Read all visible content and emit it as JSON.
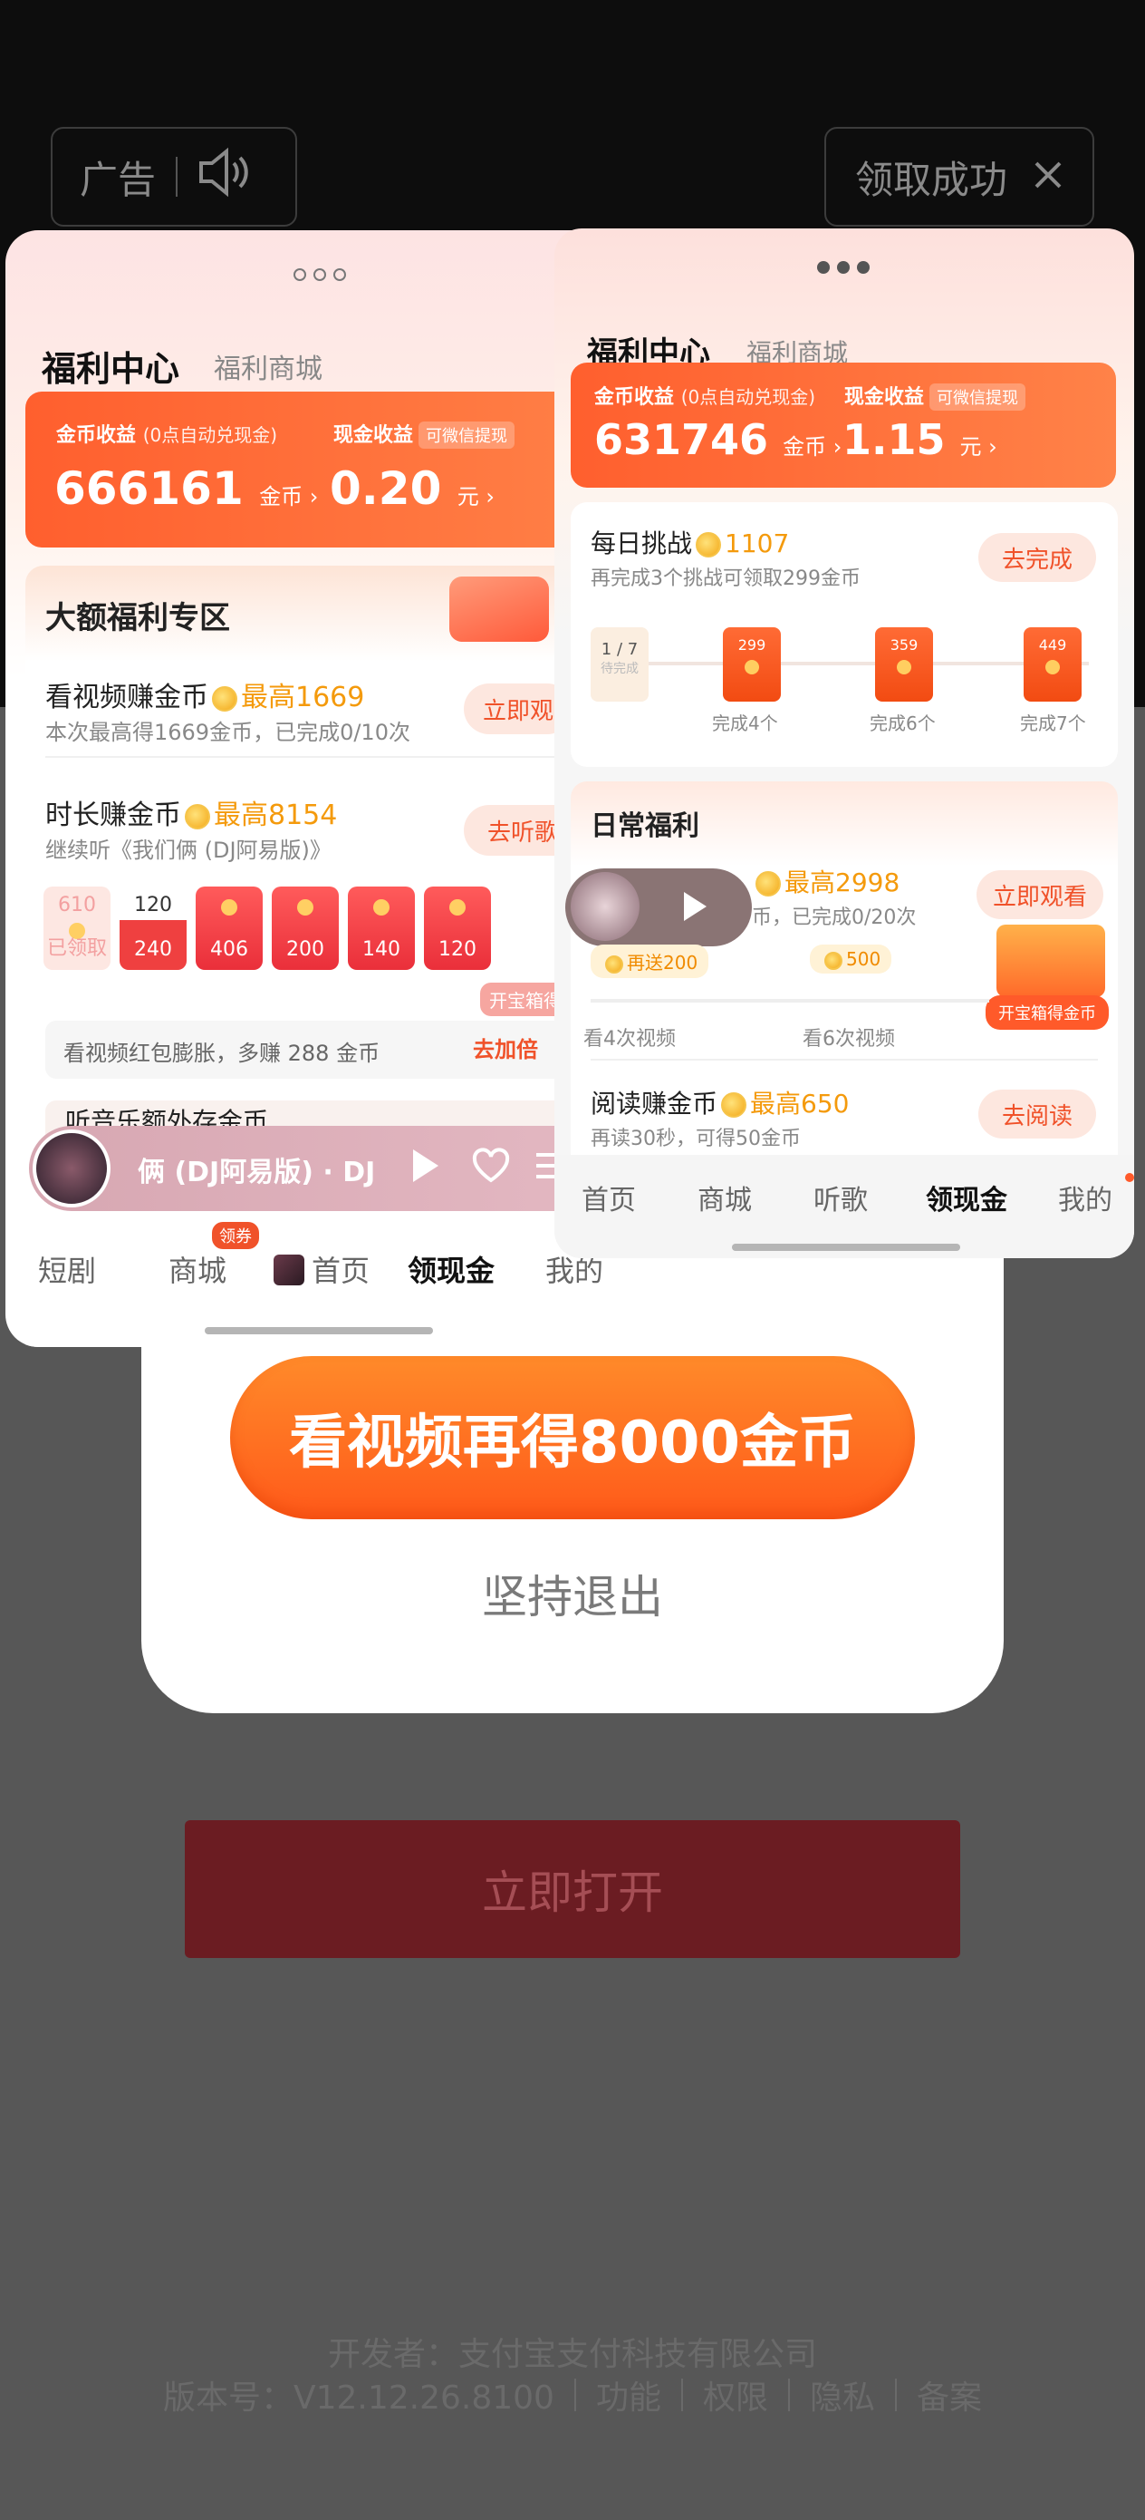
{
  "ad_bar": {
    "ad_label": "广告",
    "claim_label": "领取成功"
  },
  "dialog": {
    "cta": "看视频再得8000金币",
    "quit": "坚持退出"
  },
  "open_button": "立即打开",
  "footer": {
    "developer": "开发者：支付宝支付科技有限公司",
    "version": "版本号：V12.12.26.8100",
    "links": [
      "功能",
      "权限",
      "隐私",
      "备案"
    ]
  },
  "left_card": {
    "tabs": [
      "福利中心",
      "福利商城"
    ],
    "coin_label": "金币收益",
    "coin_note": "(0点自动兑现金)",
    "coin_value": "666161",
    "coin_unit": "金币 ›",
    "cash_label": "现金收益",
    "wechat": "可微信提现",
    "cash_value": "0.20",
    "cash_unit": "元 ›",
    "zone_title": "大额福利专区",
    "video_title": "看视频赚金币",
    "video_max": "最高1669",
    "video_sub": "本次最高得1669金币，已完成0/10次",
    "video_btn": "立即观",
    "listen_title": "时长赚金币",
    "listen_max": "最高8154",
    "listen_sub": "继续听《我们俩 (DJ阿易版)》",
    "listen_btn": "去听歌",
    "packets": [
      {
        "top": "610",
        "bottom": "已领取"
      },
      {
        "top": "120",
        "bottom": "240"
      },
      {
        "top": "",
        "bottom": "406"
      },
      {
        "top": "",
        "bottom": "200"
      },
      {
        "top": "",
        "bottom": "140"
      },
      {
        "top": "",
        "bottom": "120"
      }
    ],
    "treasure_label": "开宝箱得",
    "promo_text": "看视频红包膨胀，多赚 288 金币",
    "promo_btn": "去加倍",
    "music_extra": "听音乐额外存金币",
    "player_title": "俩 (DJ阿易版) · DJ",
    "nav": [
      "短剧",
      "商城",
      "首页",
      "领现金",
      "我的"
    ],
    "nav_badge": "领券"
  },
  "right_card": {
    "tabs": [
      "福利中心",
      "福利商城"
    ],
    "coin_label": "金币收益",
    "coin_note": "(0点自动兑现金)",
    "coin_value": "631746",
    "coin_unit": "金币 ›",
    "cash_label": "现金收益",
    "wechat": "可微信提现",
    "cash_value": "1.15",
    "cash_unit": "元 ›",
    "challenge_title": "每日挑战",
    "challenge_coins": "1107",
    "challenge_sub": "再完成3个挑战可领取299金币",
    "challenge_btn": "去完成",
    "progress_start": "1 / 7",
    "progress_start_sub": "待完成",
    "envelopes": [
      {
        "value": "299",
        "label": "完成4个"
      },
      {
        "value": "359",
        "label": "完成6个"
      },
      {
        "value": "449",
        "label": "完成7个"
      }
    ],
    "daily_title": "日常福利",
    "watch_max": "最高2998",
    "watch_sub": "币，已完成0/20次",
    "watch_btn": "立即观看",
    "bonus1": "再送200",
    "bonus2": "500",
    "milestone1": "看4次视频",
    "milestone2": "看6次视频",
    "treasure_label": "开宝箱得金币",
    "read_title": "阅读赚金币",
    "read_max": "最高650",
    "read_sub": "再读30秒，可得50金币",
    "read_btn": "去阅读",
    "nav": [
      "首页",
      "商城",
      "听歌",
      "领现金",
      "我的"
    ]
  },
  "colors": {
    "accent": "#ff5f2e",
    "gold": "#f49a0c",
    "cta": "#ff6a1f"
  }
}
